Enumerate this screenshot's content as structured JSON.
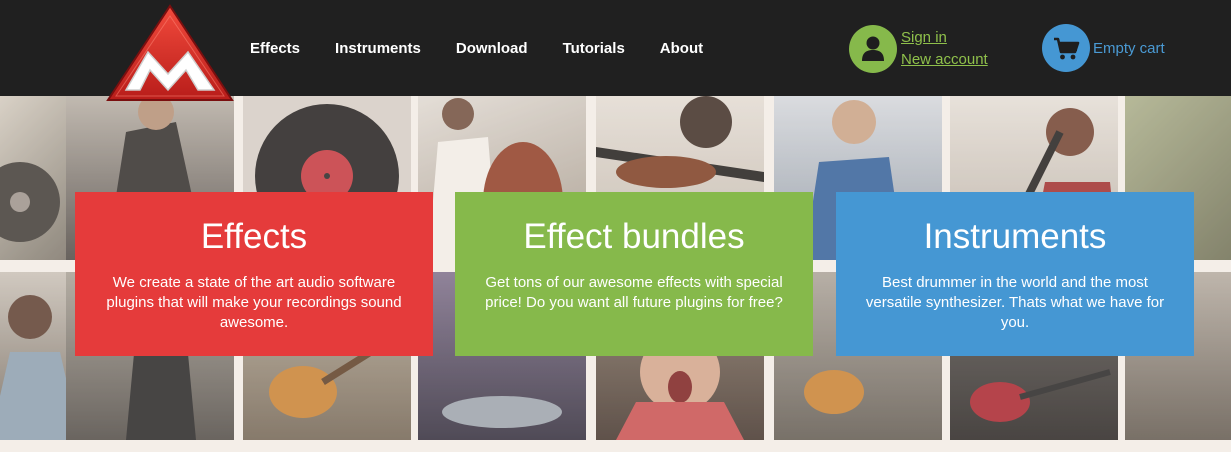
{
  "brand": {
    "logo_icon": "m-triangle-logo",
    "colors": {
      "red": "#e53b3b",
      "green": "#86b94b",
      "blue": "#4597d3"
    }
  },
  "nav": {
    "items": [
      {
        "label": "Effects"
      },
      {
        "label": "Instruments"
      },
      {
        "label": "Download"
      },
      {
        "label": "Tutorials"
      },
      {
        "label": "About"
      }
    ]
  },
  "account": {
    "icon": "user-icon",
    "sign_in": "Sign in",
    "new_account": "New account"
  },
  "cart": {
    "icon": "cart-icon",
    "label": "Empty cart"
  },
  "cards": [
    {
      "title": "Effects",
      "text": "We create a state of the art audio software plugins that will make your recordings sound awesome.",
      "color": "#e53b3b"
    },
    {
      "title": "Effect bundles",
      "text": "Get tons of our awesome effects with special price! Do you want all future plugins for free?",
      "color": "#86b94b"
    },
    {
      "title": "Instruments",
      "text": "Best drummer in the world and the most versatile synthesizer. Thats what we have for you.",
      "color": "#4597d3"
    }
  ]
}
